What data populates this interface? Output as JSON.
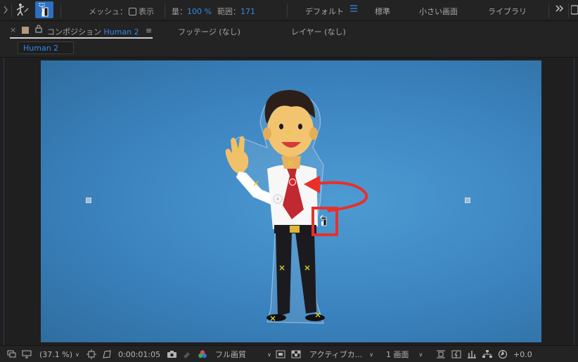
{
  "toolbar": {
    "mesh_label": "メッシュ：",
    "show_label": "表示",
    "amount_label": "量：",
    "amount_value": "100 %",
    "range_label": "範囲：",
    "range_value": "171",
    "workspaces": [
      "デフォルト",
      "標準",
      "小さい画面",
      "ライブラリ"
    ],
    "active_workspace_icon": "menu-lines-icon",
    "more_icon": "double-chevron-right-icon"
  },
  "panel": {
    "close_glyph": "×",
    "composition_label": "コンポジション",
    "composition_name": "Human 2",
    "menu_glyph": "≡",
    "footage_label": "フッテージ (なし)",
    "layer_label": "レイヤー (なし)",
    "comp_subtab": "Human 2"
  },
  "bottom_bar": {
    "zoom": "(37.1 %)",
    "timecode": "0:00:01:05",
    "resolution": "フル画質",
    "camera": "アクティブカ...",
    "views": "1 画面",
    "exposure": "+0.0"
  },
  "colors": {
    "accent": "#2d8ceb",
    "canvas_blue": "#3b83bf",
    "annotation_red": "#e8302a",
    "puppet_pin": "#e0d22a"
  }
}
